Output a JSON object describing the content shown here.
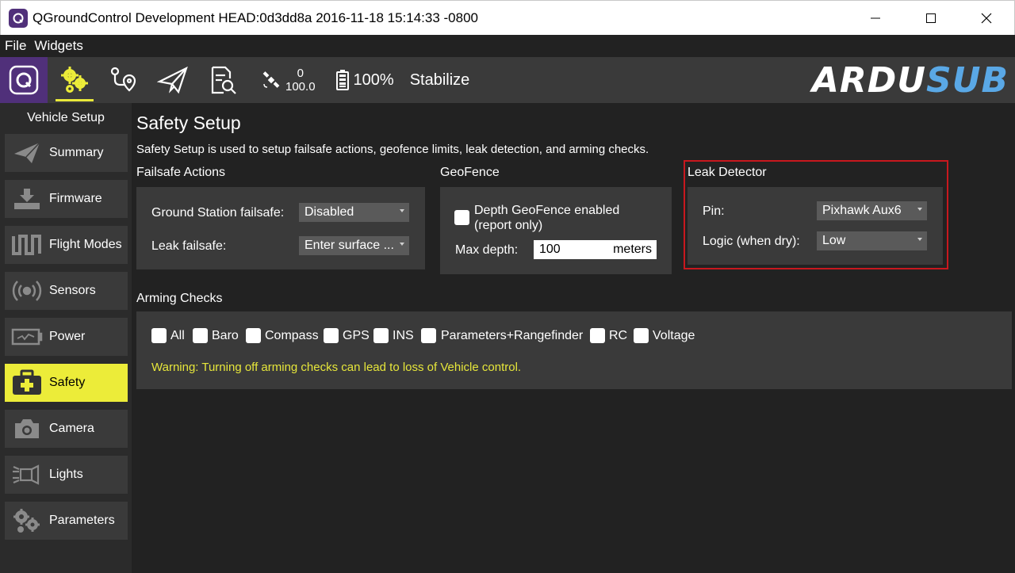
{
  "window": {
    "title": "QGroundControl Development HEAD:0d3dd8a 2016-11-18 15:14:33 -0800",
    "controls": [
      "minimize-icon",
      "maximize-icon",
      "close-icon"
    ]
  },
  "menu": {
    "items": [
      "File",
      "Widgets"
    ]
  },
  "toolbar": {
    "icons": [
      "qgc-logo-icon",
      "gear-settings-icon",
      "plan-waypoint-icon",
      "fly-paper-plane-icon",
      "analyze-icon"
    ],
    "gps_count": "0",
    "gps_hdop": "100.0",
    "battery": "100%",
    "flight_mode": "Stabilize",
    "brand_part1": "ARDU",
    "brand_part2": "SUB",
    "accent_color": "#ecec39",
    "brand_color": "#5aa8e6"
  },
  "sidebar": {
    "title": "Vehicle Setup",
    "items": [
      {
        "label": "Summary",
        "icon": "paper-plane-icon"
      },
      {
        "label": "Firmware",
        "icon": "download-icon"
      },
      {
        "label": "Flight Modes",
        "icon": "flight-modes-wave-icon"
      },
      {
        "label": "Sensors",
        "icon": "sensors-radio-icon"
      },
      {
        "label": "Power",
        "icon": "battery-icon"
      },
      {
        "label": "Safety",
        "icon": "medkit-icon",
        "active": true
      },
      {
        "label": "Camera",
        "icon": "camera-icon"
      },
      {
        "label": "Lights",
        "icon": "lights-icon"
      },
      {
        "label": "Parameters",
        "icon": "gears-icon"
      }
    ]
  },
  "page": {
    "title": "Safety Setup",
    "description": "Safety Setup is used to setup failsafe actions, geofence limits, leak detection, and arming checks."
  },
  "failsafe": {
    "title": "Failsafe Actions",
    "gcs_label": "Ground Station failsafe:",
    "gcs_value": "Disabled",
    "leak_label": "Leak failsafe:",
    "leak_value": "Enter surface ..."
  },
  "geofence": {
    "title": "GeoFence",
    "depth_check_label_line1": "Depth GeoFence enabled",
    "depth_check_label_line2": "(report only)",
    "depth_check_checked": false,
    "max_depth_label": "Max depth:",
    "max_depth_value": "100",
    "max_depth_units": "meters"
  },
  "leak_detector": {
    "title": "Leak Detector",
    "pin_label": "Pin:",
    "pin_value": "Pixhawk Aux6",
    "logic_label": "Logic (when dry):",
    "logic_value": "Low",
    "highlight_color": "#c8181e"
  },
  "arming": {
    "title": "Arming Checks",
    "checks": [
      {
        "label": "All",
        "checked": false
      },
      {
        "label": "Baro",
        "checked": false
      },
      {
        "label": "Compass",
        "checked": false
      },
      {
        "label": "GPS",
        "checked": false
      },
      {
        "label": "INS",
        "checked": false
      },
      {
        "label": "Parameters+Rangefinder",
        "checked": false
      },
      {
        "label": "RC",
        "checked": false
      },
      {
        "label": "Voltage",
        "checked": false
      }
    ],
    "warning": "Warning: Turning off arming checks can lead to loss of Vehicle control.",
    "warning_color": "#e6e63a"
  }
}
